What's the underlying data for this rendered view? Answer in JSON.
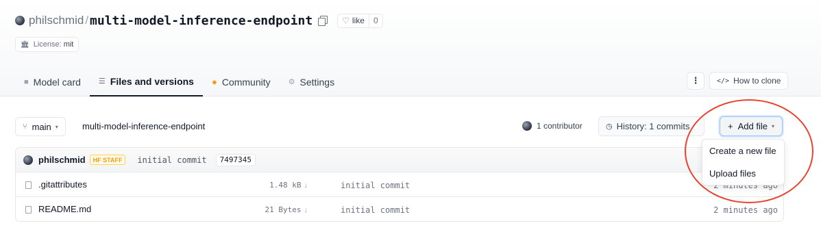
{
  "header": {
    "owner": "philschmid",
    "separator": "/",
    "repo_name": "multi-model-inference-endpoint",
    "like_label": "like",
    "like_count": "0",
    "license_key": "License:",
    "license_value": "mit"
  },
  "tabs": [
    {
      "label": "Model card",
      "icon": "cube-icon"
    },
    {
      "label": "Files and versions",
      "icon": "list-icon",
      "active": true
    },
    {
      "label": "Community",
      "icon": "community-icon"
    },
    {
      "label": "Settings",
      "icon": "gear-icon"
    }
  ],
  "actions": {
    "more_label": "⋮",
    "clone_label": "How to clone"
  },
  "toolbar": {
    "branch": "main",
    "path": "multi-model-inference-endpoint",
    "contributors": "1 contributor",
    "history": "History: 1 commits",
    "add_file": "Add file"
  },
  "commit": {
    "author": "philschmid",
    "badge": "HF STAFF",
    "message": "initial commit",
    "hash": "7497345"
  },
  "files": [
    {
      "name": ".gitattributes",
      "size": "1.48 kB",
      "message": "initial commit",
      "time": "2 minutes ago"
    },
    {
      "name": "README.md",
      "size": "21 Bytes",
      "message": "initial commit",
      "time": "2 minutes ago"
    }
  ],
  "add_file_menu": [
    {
      "label": "Create a new file"
    },
    {
      "label": "Upload files"
    }
  ],
  "colors": {
    "annotation": "#e8432e",
    "staff_badge": "#f59e0b",
    "focus_ring": "#93c5fd"
  }
}
